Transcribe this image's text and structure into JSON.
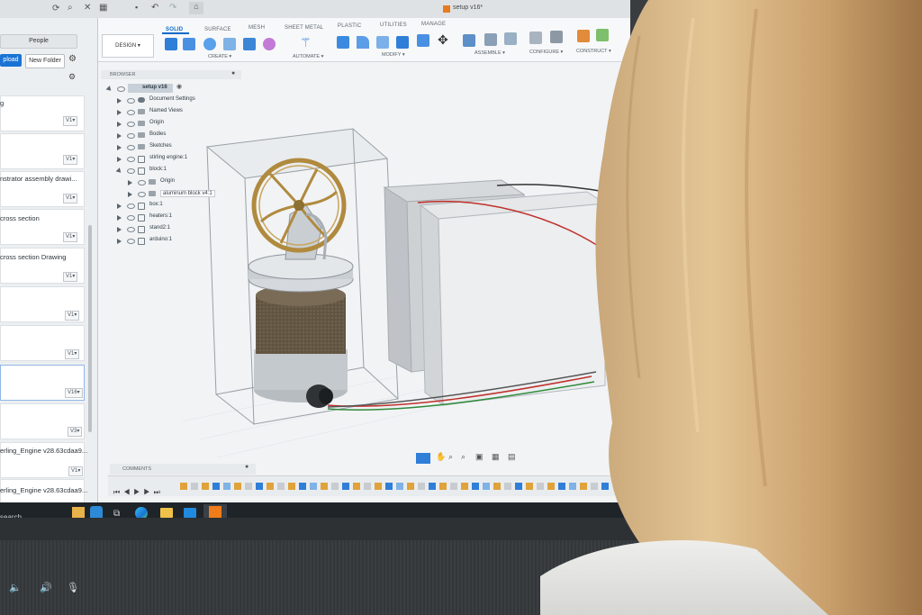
{
  "app": {
    "window_title": "setup v16*",
    "mode": "DESIGN ▾"
  },
  "ribbon": {
    "tabs": [
      "SOLID",
      "SURFACE",
      "MESH",
      "SHEET METAL",
      "PLASTIC",
      "UTILITIES",
      "MANAGE"
    ],
    "active_tab": "SOLID",
    "groups": [
      "CREATE ▾",
      "AUTOMATE ▾",
      "MODIFY ▾",
      "ASSEMBLE ▾",
      "CONFIGURE ▾",
      "CONSTRUCT ▾"
    ]
  },
  "left_panel": {
    "people_label": "People",
    "upload_label": "pload",
    "new_folder_label": "New Folder",
    "items": [
      {
        "name": "g",
        "version": "V1▾"
      },
      {
        "name": "",
        "version": "V1▾"
      },
      {
        "name": "nstrator assembly drawi...",
        "version": "V1▾"
      },
      {
        "name": "cross section",
        "version": "V1▾"
      },
      {
        "name": "cross section Drawing",
        "version": "V1▾"
      },
      {
        "name": "",
        "version": "V1▾"
      },
      {
        "name": "",
        "version": "V1▾"
      },
      {
        "name": "",
        "version": "V16▾"
      },
      {
        "name": "",
        "version": "V3▾"
      },
      {
        "name": "erling_Engine v28.63cdaa9...",
        "version": "V1▾"
      },
      {
        "name": "erling_Engine v28.63cdaa9...",
        "version": ""
      }
    ],
    "search_label": "search"
  },
  "browser": {
    "header": "BROWSER",
    "root": "setup v16",
    "nodes": [
      "Document Settings",
      "Named Views",
      "Origin",
      "Bodies",
      "Sketches",
      "stirling engine:1",
      "block:1",
      "Origin",
      "aluminum block v4:1",
      "box:1",
      "heaters:1",
      "stand2:1",
      "arduino:1"
    ]
  },
  "comments_label": "COMMENTS",
  "colors": {
    "accent": "#0b6bc9",
    "screen_bg": "#f1f3f5",
    "taskbar": "#1f2429",
    "hair": "#d9b88a",
    "wire_red": "#c0302a",
    "wire_green": "#2e8a3a",
    "brass": "#b08a3e",
    "cork": "#6b5d4a"
  },
  "icons": [
    "refresh-icon",
    "search-icon",
    "close-icon",
    "grid-icon",
    "undo-icon",
    "redo-icon",
    "home-icon",
    "gear-icon",
    "eye-icon",
    "folder-icon",
    "edge-icon",
    "explorer-icon",
    "mail-icon",
    "fusion-icon",
    "speaker-icon",
    "mic-mute-icon"
  ]
}
